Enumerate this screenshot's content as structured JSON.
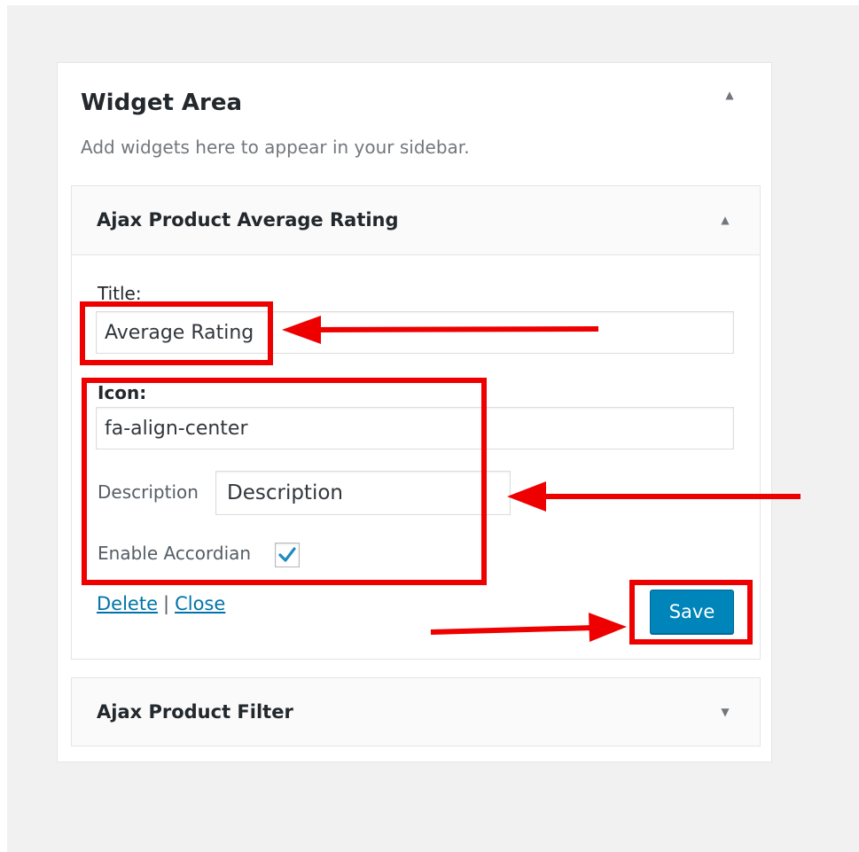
{
  "widget_area": {
    "title": "Widget Area",
    "description": "Add widgets here to appear in your sidebar."
  },
  "rating_widget": {
    "title": "Ajax Product Average Rating",
    "expanded": true,
    "fields": {
      "title_label": "Title:",
      "title_value": "Average Rating",
      "icon_label": "Icon:",
      "icon_value": "fa-align-center",
      "description_label": "Description",
      "description_value": "Description",
      "accordion_label": "Enable Accordian",
      "accordion_checked": true
    },
    "actions": {
      "delete_label": "Delete",
      "separator": "|",
      "close_label": "Close",
      "save_label": "Save"
    }
  },
  "filter_widget": {
    "title": "Ajax Product Filter",
    "expanded": false
  },
  "colors": {
    "highlight": "#ee0000",
    "save_button": "#0085ba",
    "link": "#0073aa"
  },
  "icons": {
    "collapse": "triangle-up-icon",
    "expand": "triangle-down-icon",
    "check": "checkmark-icon"
  }
}
